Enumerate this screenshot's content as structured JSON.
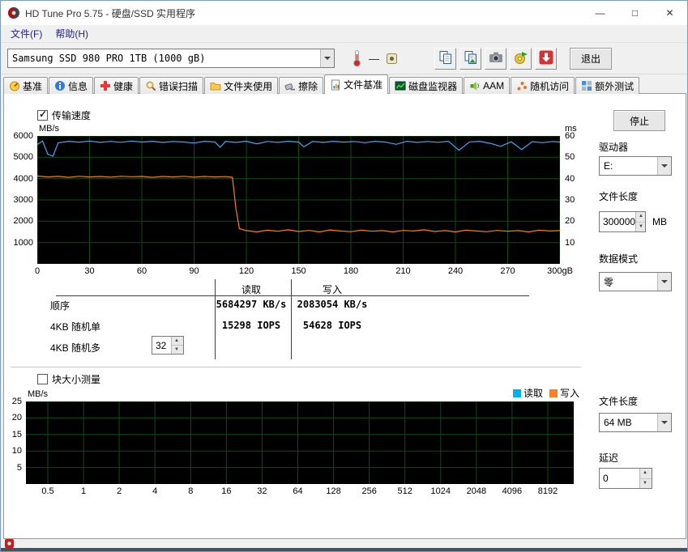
{
  "window": {
    "title": "HD Tune Pro 5.75 - 硬盘/SSD 实用程序",
    "minimize": "—",
    "maximize": "□",
    "close": "✕"
  },
  "menu": {
    "items": [
      {
        "name": "menu-file",
        "label": "文件(F)"
      },
      {
        "name": "menu-help",
        "label": "帮助(H)"
      }
    ]
  },
  "toolbar": {
    "drive_selected": "Samsung SSD 980 PRO 1TB (1000 gB)",
    "temperature_value": "—",
    "buttons": [
      {
        "name": "copy-text-button",
        "icon": "copy-icon"
      },
      {
        "name": "copy-image-button",
        "icon": "copy-image-icon"
      },
      {
        "name": "screenshot-button",
        "icon": "camera-icon"
      },
      {
        "name": "export-button",
        "icon": "export-icon"
      },
      {
        "name": "save-button",
        "icon": "download-icon"
      }
    ],
    "exit_label": "退出"
  },
  "tabs": [
    {
      "name": "tab-benchmark",
      "label": "基准",
      "icon": "gauge-icon",
      "active": false
    },
    {
      "name": "tab-info",
      "label": "信息",
      "icon": "info-icon",
      "active": false
    },
    {
      "name": "tab-health",
      "label": "健康",
      "icon": "health-icon",
      "active": false
    },
    {
      "name": "tab-error-scan",
      "label": "错误扫描",
      "icon": "scan-icon",
      "active": false
    },
    {
      "name": "tab-folder-usage",
      "label": "文件夹使用",
      "icon": "folder-icon",
      "active": false
    },
    {
      "name": "tab-erase",
      "label": "擦除",
      "icon": "erase-icon",
      "active": false
    },
    {
      "name": "tab-file-benchmark",
      "label": "文件基准",
      "icon": "file-benchmark-icon",
      "active": true
    },
    {
      "name": "tab-disk-monitor",
      "label": "磁盘监视器",
      "icon": "disk-monitor-icon",
      "active": false
    },
    {
      "name": "tab-aam",
      "label": "AAM",
      "icon": "aam-icon",
      "active": false
    },
    {
      "name": "tab-random-access",
      "label": "随机访问",
      "icon": "random-access-icon",
      "active": false
    },
    {
      "name": "tab-extra-tests",
      "label": "额外测试",
      "icon": "extra-tests-icon",
      "active": false
    }
  ],
  "file_benchmark": {
    "transfer_speed_label": "传输速度",
    "transfer_speed_checked": true,
    "results": {
      "read_header": "读取",
      "write_header": "写入",
      "rows": [
        {
          "name": "row-sequential",
          "label": "顺序",
          "read": "5684297 KB/s",
          "write": "2083054 KB/s"
        },
        {
          "name": "row-4kb-random-single",
          "label": "4KB 随机单",
          "read": "15298 IOPS",
          "write": "54628 IOPS"
        },
        {
          "name": "row-4kb-random-multi",
          "label": "4KB 随机多",
          "read": "",
          "write": "",
          "queue_depth": "32"
        }
      ]
    },
    "controls": {
      "stop_label": "停止",
      "drive_label": "驱动器",
      "drive_value": "E:",
      "file_length_label": "文件长度",
      "file_length_value": "300000",
      "file_length_unit": "MB",
      "data_mode_label": "数据模式",
      "data_mode_value": "零"
    }
  },
  "block_test": {
    "checkbox_label": "块大小测量",
    "checkbox_checked": false,
    "legend": [
      {
        "label": "读取",
        "color": "#00b0f0"
      },
      {
        "label": "写入",
        "color": "#ff7f27"
      }
    ],
    "controls": {
      "file_length_label": "文件长度",
      "file_length_value": "64 MB",
      "delay_label": "延迟",
      "delay_value": "0"
    }
  },
  "chart_data": [
    {
      "type": "line",
      "title": "传输速度",
      "ylabel_left": "MB/s",
      "ylabel_right": "ms",
      "xlim": [
        0,
        300
      ],
      "ylim_left": [
        0,
        6000
      ],
      "ylim_right": [
        0,
        60
      ],
      "x_ticks": [
        0,
        30,
        60,
        90,
        120,
        150,
        180,
        210,
        240,
        270,
        300
      ],
      "x_tick_labels": [
        "0",
        "30",
        "60",
        "90",
        "120",
        "150",
        "180",
        "210",
        "240",
        "270",
        "300gB"
      ],
      "y_ticks_left": [
        1000,
        2000,
        3000,
        4000,
        5000,
        6000
      ],
      "y_ticks_right": [
        10,
        20,
        30,
        40,
        50,
        60
      ],
      "grid": true,
      "background": "#000000",
      "grid_color": "#0c4d0c",
      "legend_position": "none",
      "series": [
        {
          "name": "读取",
          "color": "#3fa9f5",
          "points": [
            [
              0,
              5600
            ],
            [
              3,
              5760
            ],
            [
              6,
              5150
            ],
            [
              9,
              5050
            ],
            [
              12,
              5680
            ],
            [
              18,
              5750
            ],
            [
              24,
              5710
            ],
            [
              30,
              5760
            ],
            [
              36,
              5700
            ],
            [
              42,
              5745
            ],
            [
              48,
              5705
            ],
            [
              54,
              5760
            ],
            [
              60,
              5715
            ],
            [
              66,
              5750
            ],
            [
              72,
              5700
            ],
            [
              78,
              5740
            ],
            [
              84,
              5715
            ],
            [
              90,
              5670
            ],
            [
              96,
              5750
            ],
            [
              102,
              5715
            ],
            [
              105,
              5470
            ],
            [
              108,
              5740
            ],
            [
              114,
              5700
            ],
            [
              120,
              5755
            ],
            [
              126,
              5630
            ],
            [
              132,
              5740
            ],
            [
              138,
              5700
            ],
            [
              144,
              5750
            ],
            [
              150,
              5715
            ],
            [
              153,
              5490
            ],
            [
              158,
              5740
            ],
            [
              164,
              5700
            ],
            [
              170,
              5750
            ],
            [
              176,
              5710
            ],
            [
              182,
              5740
            ],
            [
              188,
              5685
            ],
            [
              194,
              5750
            ],
            [
              200,
              5710
            ],
            [
              206,
              5610
            ],
            [
              212,
              5750
            ],
            [
              218,
              5700
            ],
            [
              224,
              5740
            ],
            [
              230,
              5705
            ],
            [
              236,
              5750
            ],
            [
              242,
              5330
            ],
            [
              248,
              5720
            ],
            [
              254,
              5750
            ],
            [
              260,
              5655
            ],
            [
              266,
              5515
            ],
            [
              272,
              5730
            ],
            [
              278,
              5365
            ],
            [
              284,
              5730
            ],
            [
              290,
              5690
            ],
            [
              296,
              5740
            ],
            [
              300,
              5710
            ]
          ]
        },
        {
          "name": "写入",
          "color": "#ff8000",
          "points": [
            [
              0,
              4120
            ],
            [
              6,
              4080
            ],
            [
              12,
              4105
            ],
            [
              18,
              4060
            ],
            [
              24,
              4110
            ],
            [
              30,
              4080
            ],
            [
              36,
              4100
            ],
            [
              42,
              4070
            ],
            [
              48,
              4110
            ],
            [
              54,
              4090
            ],
            [
              60,
              4100
            ],
            [
              66,
              4060
            ],
            [
              72,
              4100
            ],
            [
              78,
              4080
            ],
            [
              84,
              4110
            ],
            [
              90,
              4070
            ],
            [
              96,
              4100
            ],
            [
              102,
              4080
            ],
            [
              108,
              4095
            ],
            [
              112,
              4060
            ],
            [
              114,
              2600
            ],
            [
              116,
              1650
            ],
            [
              120,
              1560
            ],
            [
              126,
              1500
            ],
            [
              132,
              1580
            ],
            [
              138,
              1530
            ],
            [
              144,
              1600
            ],
            [
              150,
              1520
            ],
            [
              156,
              1570
            ],
            [
              162,
              1500
            ],
            [
              168,
              1590
            ],
            [
              174,
              1540
            ],
            [
              180,
              1510
            ],
            [
              186,
              1580
            ],
            [
              192,
              1530
            ],
            [
              198,
              1560
            ],
            [
              204,
              1500
            ],
            [
              210,
              1570
            ],
            [
              216,
              1540
            ],
            [
              222,
              1600
            ],
            [
              228,
              1520
            ],
            [
              234,
              1560
            ],
            [
              240,
              1500
            ],
            [
              246,
              1580
            ],
            [
              252,
              1540
            ],
            [
              258,
              1510
            ],
            [
              264,
              1570
            ],
            [
              270,
              1530
            ],
            [
              276,
              1560
            ],
            [
              282,
              1500
            ],
            [
              288,
              1580
            ],
            [
              294,
              1540
            ],
            [
              300,
              1560
            ]
          ]
        }
      ]
    },
    {
      "type": "line",
      "title": "块大小测量",
      "ylabel_left": "MB/s",
      "x_tick_labels": [
        "0.5",
        "1",
        "2",
        "4",
        "8",
        "16",
        "32",
        "64",
        "128",
        "256",
        "512",
        "1024",
        "2048",
        "4096",
        "8192"
      ],
      "y_ticks_left": [
        5,
        10,
        15,
        20,
        25
      ],
      "ylim_left": [
        0,
        25
      ],
      "grid": true,
      "background": "#000000",
      "grid_color": "#0c4d0c",
      "legend_position": "top-right",
      "series": []
    }
  ]
}
